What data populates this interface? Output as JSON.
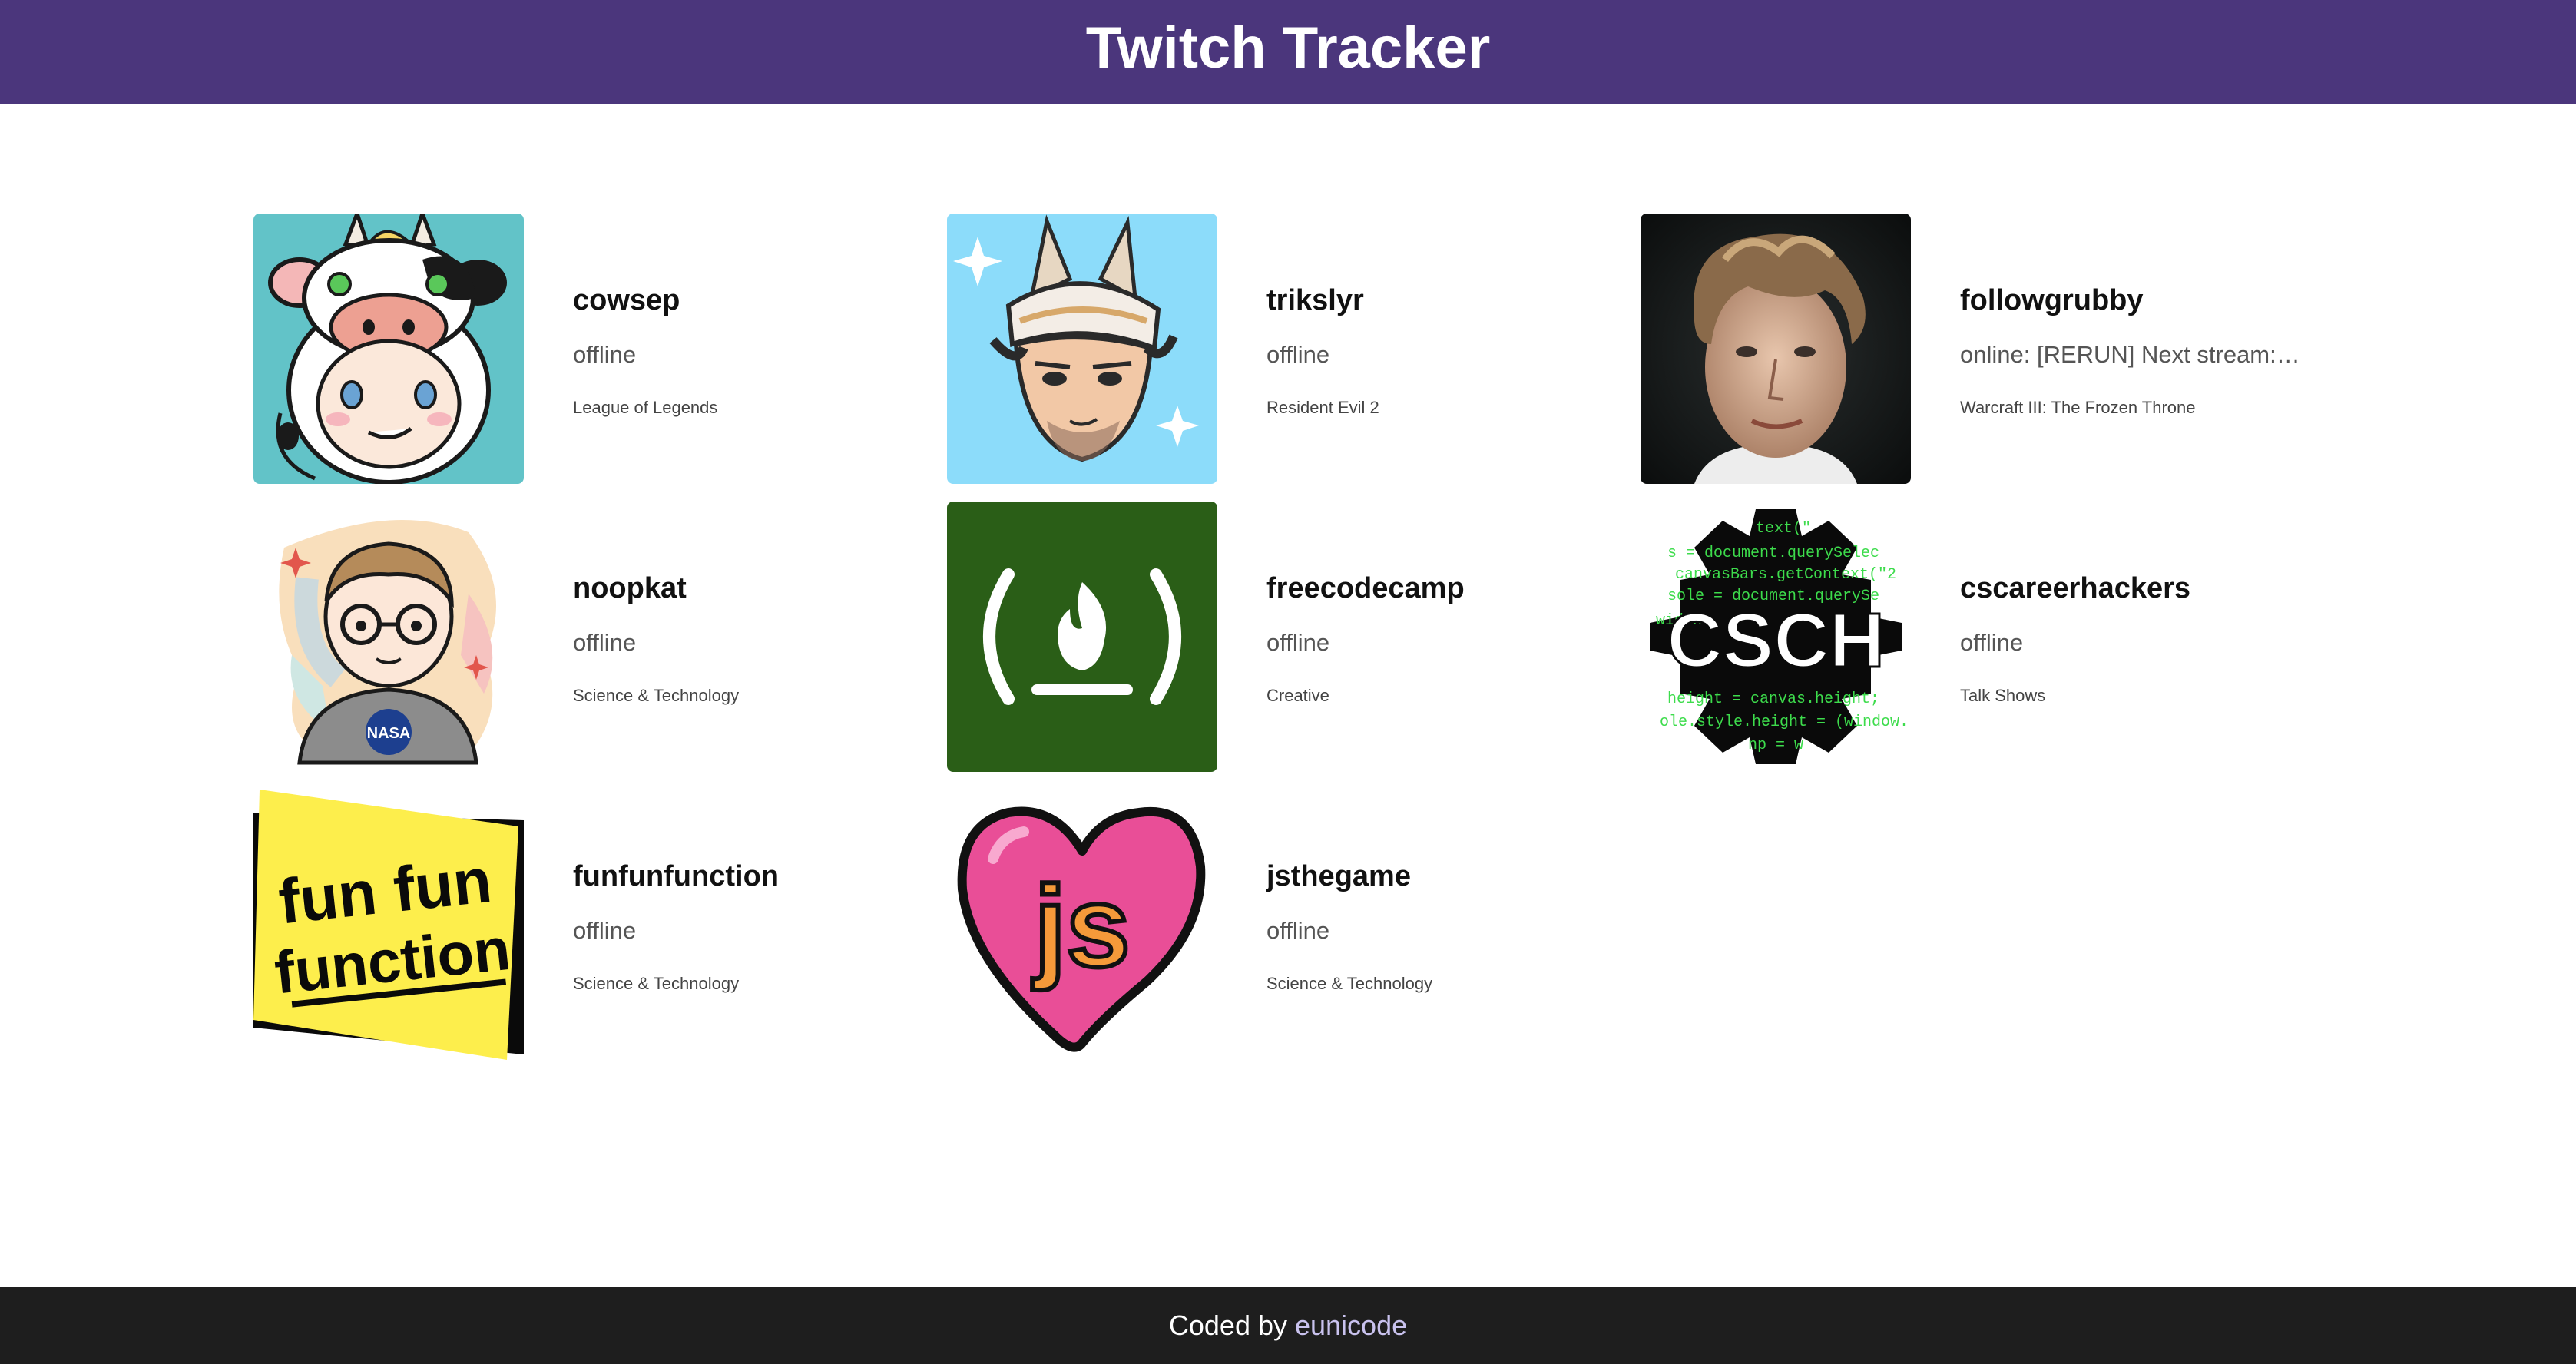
{
  "header": {
    "title": "Twitch Tracker"
  },
  "streamers": [
    {
      "name": "cowsep",
      "status": "offline",
      "game": "League of Legends",
      "avatar_icon": "cow-avatar-icon"
    },
    {
      "name": "trikslyr",
      "status": "offline",
      "game": "Resident Evil 2",
      "avatar_icon": "horned-character-avatar-icon"
    },
    {
      "name": "followgrubby",
      "status": "online: [RERUN] Next stream:…",
      "game": "Warcraft III: The Frozen Throne",
      "avatar_icon": "portrait-avatar-icon"
    },
    {
      "name": "noopkat",
      "status": "offline",
      "game": "Science & Technology",
      "avatar_icon": "glasses-character-avatar-icon"
    },
    {
      "name": "freecodecamp",
      "status": "offline",
      "game": "Creative",
      "avatar_icon": "campfire-logo-icon"
    },
    {
      "name": "cscareerhackers",
      "status": "offline",
      "game": "Talk Shows",
      "avatar_icon": "gear-logo-icon"
    },
    {
      "name": "funfunfunction",
      "status": "offline",
      "game": "Science & Technology",
      "avatar_icon": "funfunfunction-logo-icon"
    },
    {
      "name": "jsthegame",
      "status": "offline",
      "game": "Science & Technology",
      "avatar_icon": "heart-logo-icon"
    }
  ],
  "avatar_art": {
    "csch_text": "CSCH",
    "csch_code_lines": [
      "text(\"",
      "s = document.querySelec",
      "canvasBars.getContext(\"2",
      "sole = document.querySe",
      "width",
      "height = canvas.height;",
      "ole.style.height = (window.",
      "np = w"
    ],
    "fff_lines": [
      "fun fun",
      "function"
    ],
    "fff_icon_text": "js",
    "nasa_text": "NASA"
  },
  "footer": {
    "prefix": "Coded by",
    "author": "eunicode"
  },
  "colors": {
    "header_bg": "#4b367c",
    "footer_bg": "#1e1e1e",
    "footer_link": "#c9c2ee",
    "freecodecamp_green": "#2a5e17",
    "online_text": "#555555"
  }
}
